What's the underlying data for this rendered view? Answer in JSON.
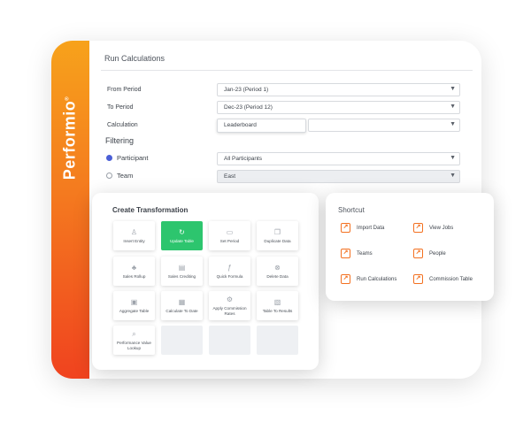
{
  "brand": {
    "name": "Performio",
    "mark": "®"
  },
  "run_calculations": {
    "title": "Run Calculations",
    "from_period": {
      "label": "From Period",
      "value": "Jan-23 (Period 1)"
    },
    "to_period": {
      "label": "To Period",
      "value": "Dec-23 (Period 12)"
    },
    "calculation": {
      "label": "Calculation",
      "value": "Leaderboard",
      "secondary_value": ""
    }
  },
  "filtering": {
    "heading": "Filtering",
    "participant": {
      "label": "Participant",
      "value": "All Participants",
      "selected": true
    },
    "team": {
      "label": "Team",
      "value": "East",
      "selected": false
    }
  },
  "create_transformation": {
    "title": "Create Transformation",
    "tiles": [
      {
        "label": "Insert Entity",
        "icon": "user-icon",
        "glyph": "♙"
      },
      {
        "label": "Update Table",
        "icon": "refresh-icon",
        "glyph": "↻"
      },
      {
        "label": "Set Period",
        "icon": "calendar-icon",
        "glyph": "▭"
      },
      {
        "label": "Duplicate Data",
        "icon": "copy-icon",
        "glyph": "❐"
      },
      {
        "label": "Sales Rollup",
        "icon": "hierarchy-icon",
        "glyph": "♣"
      },
      {
        "label": "Sales Crediting",
        "icon": "credit-icon",
        "glyph": "▤"
      },
      {
        "label": "Quick Formula",
        "icon": "formula-icon",
        "glyph": "ƒ"
      },
      {
        "label": "Delete Data",
        "icon": "delete-icon",
        "glyph": "⊗"
      },
      {
        "label": "Aggregate Table",
        "icon": "aggregate-icon",
        "glyph": "▣"
      },
      {
        "label": "Calculate To Date",
        "icon": "calculator-icon",
        "glyph": "▦"
      },
      {
        "label": "Apply Commission Rates",
        "icon": "gear-icon",
        "glyph": "⚙"
      },
      {
        "label": "Table To Results",
        "icon": "results-icon",
        "glyph": "▧"
      },
      {
        "label": "Performance Value Lookup",
        "icon": "search-icon",
        "glyph": "⌕"
      }
    ],
    "active_tile": "Update Table"
  },
  "shortcut": {
    "title": "Shortcut",
    "items": [
      {
        "label": "Import Data",
        "icon": "shortcut-arrow-icon"
      },
      {
        "label": "View Jobs",
        "icon": "shortcut-arrow-icon"
      },
      {
        "label": "Teams",
        "icon": "shortcut-arrow-icon"
      },
      {
        "label": "People",
        "icon": "shortcut-arrow-icon"
      },
      {
        "label": "Run Calculations",
        "icon": "shortcut-arrow-icon"
      },
      {
        "label": "Commission Table",
        "icon": "shortcut-arrow-icon"
      }
    ]
  },
  "colors": {
    "brand_orange_top": "#f7a21b",
    "brand_orange_bottom": "#f0431f",
    "active_tile_green": "#2dc56e",
    "radio_selected_blue": "#4b5fd6",
    "shortcut_icon_orange": "#f37121"
  }
}
